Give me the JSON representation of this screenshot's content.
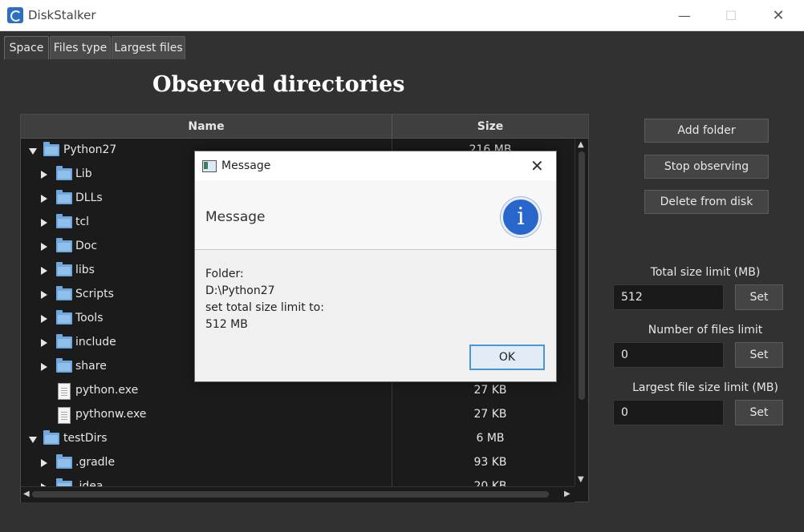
{
  "window": {
    "title": "DiskStalker",
    "min_glyph": "—",
    "max_glyph": "☐",
    "close_glyph": "✕"
  },
  "tabs": [
    {
      "label": "Space"
    },
    {
      "label": "Files type"
    },
    {
      "label": "Largest files"
    }
  ],
  "main": {
    "heading": "Observed directories"
  },
  "tree": {
    "columns": {
      "name": "Name",
      "size": "Size"
    },
    "rows": [
      {
        "label": "Python27",
        "size": "216 MB"
      },
      {
        "label": "Lib",
        "size": ""
      },
      {
        "label": "DLLs",
        "size": ""
      },
      {
        "label": "tcl",
        "size": ""
      },
      {
        "label": "Doc",
        "size": ""
      },
      {
        "label": "libs",
        "size": ""
      },
      {
        "label": "Scripts",
        "size": ""
      },
      {
        "label": "Tools",
        "size": ""
      },
      {
        "label": "include",
        "size": ""
      },
      {
        "label": "share",
        "size": ""
      },
      {
        "label": "python.exe",
        "size": "27 KB"
      },
      {
        "label": "pythonw.exe",
        "size": "27 KB"
      },
      {
        "label": "testDirs",
        "size": "6 MB"
      },
      {
        "label": ".gradle",
        "size": "93 KB"
      },
      {
        "label": ".idea",
        "size": "20 KB"
      }
    ]
  },
  "actions": {
    "add_folder": "Add folder",
    "stop_observing": "Stop observing",
    "delete_from_disk": "Delete from disk"
  },
  "limits": {
    "total": {
      "label": "Total size limit (MB)",
      "value": "512",
      "button": "Set"
    },
    "files": {
      "label": "Number of files limit",
      "value": "0",
      "button": "Set"
    },
    "largest": {
      "label": "Largest file size limit (MB)",
      "value": "0",
      "button": "Set"
    }
  },
  "dialog": {
    "title": "Message",
    "header": "Message",
    "info_glyph": "i",
    "body": [
      "Folder:",
      "D:\\Python27",
      "set total size limit to:",
      "512 MB"
    ],
    "ok": "OK",
    "close_glyph": "✕"
  }
}
